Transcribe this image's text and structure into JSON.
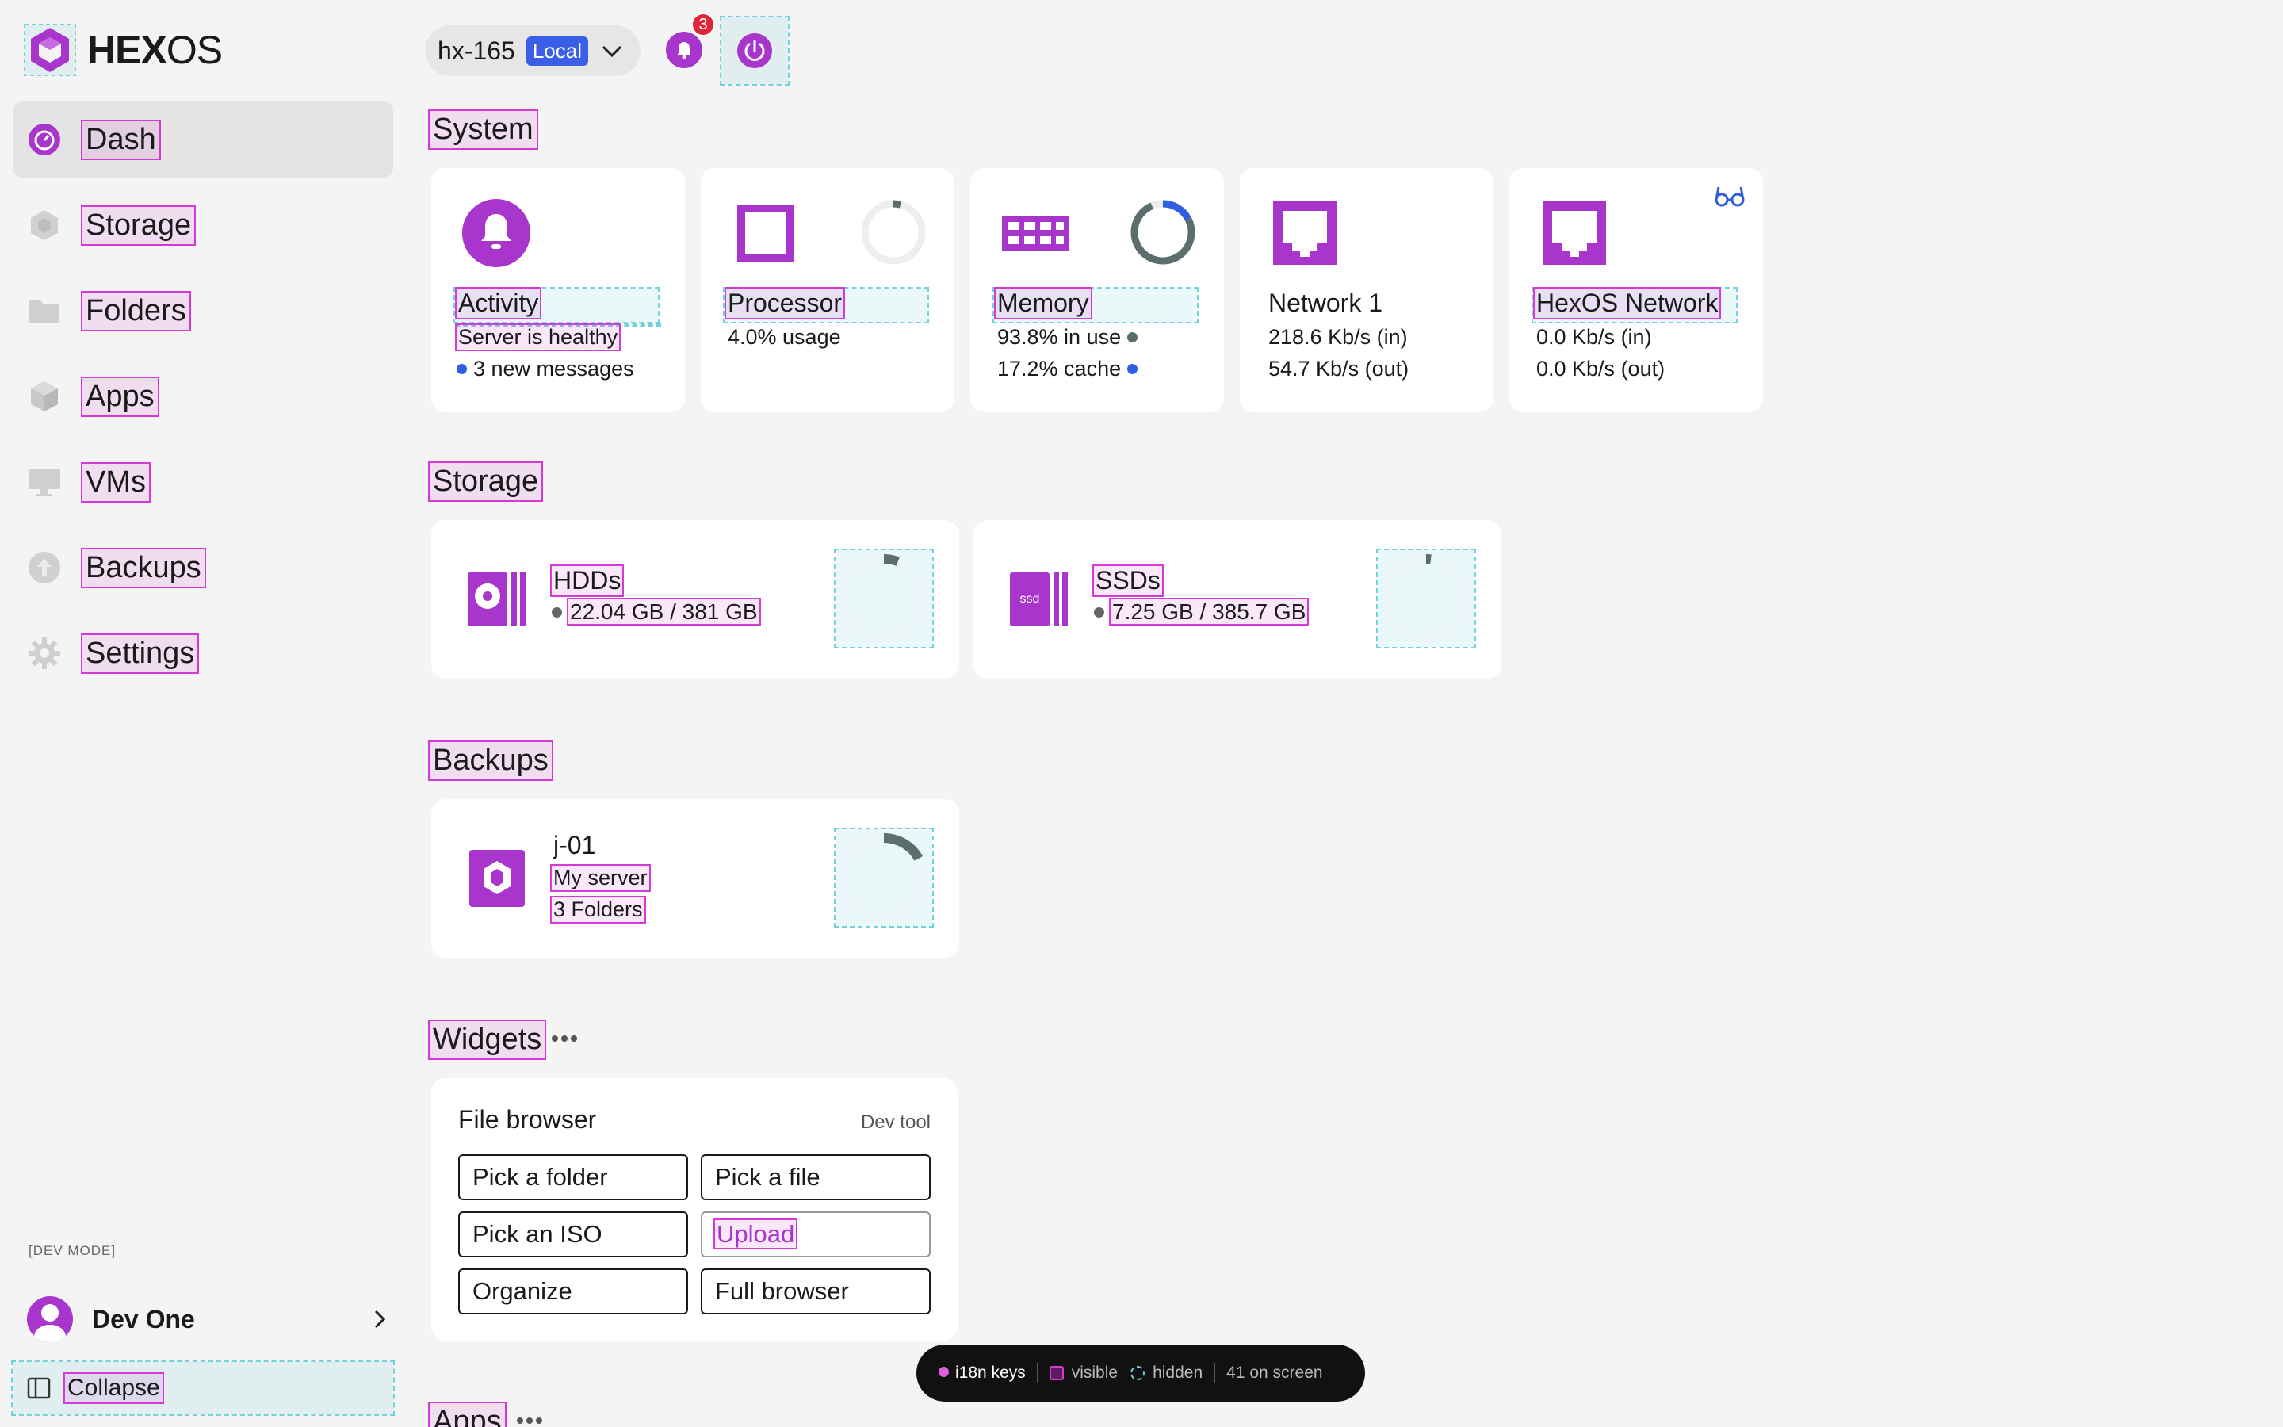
{
  "app": {
    "logo_text_bold": "HEX",
    "logo_text_rest": "OS"
  },
  "sidebar": {
    "items": [
      {
        "label": "Dash",
        "icon": "dashboard-icon",
        "active": true
      },
      {
        "label": "Storage",
        "icon": "storage-hexagon-icon"
      },
      {
        "label": "Folders",
        "icon": "folder-icon"
      },
      {
        "label": "Apps",
        "icon": "apps-cube-icon"
      },
      {
        "label": "VMs",
        "icon": "monitor-icon"
      },
      {
        "label": "Backups",
        "icon": "backup-upload-icon"
      },
      {
        "label": "Settings",
        "icon": "gear-icon"
      }
    ],
    "dev_mode_label": "[DEV MODE]",
    "user_name": "Dev One",
    "collapse_label": "Collapse"
  },
  "topbar": {
    "server_name": "hx-165",
    "server_badge": "Local",
    "notification_count": "3"
  },
  "sections": {
    "system": "System",
    "storage": "Storage",
    "backups": "Backups",
    "widgets": "Widgets",
    "apps": "Apps"
  },
  "system_cards": {
    "activity": {
      "title": "Activity",
      "status": "Server is healthy",
      "messages": "3 new messages"
    },
    "processor": {
      "title": "Processor",
      "usage": "4.0% usage",
      "usage_fraction": 0.04
    },
    "memory": {
      "title": "Memory",
      "in_use": "93.8% in use",
      "cache": "17.2% cache",
      "in_use_fraction": 0.938,
      "cache_fraction": 0.172
    },
    "network1": {
      "title": "Network 1",
      "in": "218.6 Kb/s (in)",
      "out": "54.7 Kb/s (out)"
    },
    "hexos_network": {
      "title": "HexOS Network",
      "in": "0.0 Kb/s (in)",
      "out": "0.0 Kb/s (out)"
    }
  },
  "storage_cards": {
    "hdds": {
      "title": "HDDs",
      "usage": "22.04 GB / 381 GB",
      "fraction": 0.058
    },
    "ssds": {
      "title": "SSDs",
      "usage": "7.25 GB / 385.7 GB",
      "fraction": 0.019,
      "icon_text": "ssd"
    }
  },
  "backup_card": {
    "name": "j-01",
    "server": "My server",
    "folders": "3 Folders",
    "fraction": 0.17
  },
  "widgets": {
    "file_browser": {
      "title": "File browser",
      "tag": "Dev tool",
      "buttons": [
        "Pick a folder",
        "Pick a file",
        "Pick an ISO",
        "Upload",
        "Organize",
        "Full browser"
      ]
    }
  },
  "i18n_bar": {
    "keys": "i18n keys",
    "visible": "visible",
    "hidden": "hidden",
    "count": "41 on screen"
  },
  "colors": {
    "accent": "#a835cc",
    "badge": "#3a5ee8",
    "alert": "#e0263b",
    "memory_ring": "#5a6e6e",
    "cache_blue": "#2f5fe0"
  }
}
